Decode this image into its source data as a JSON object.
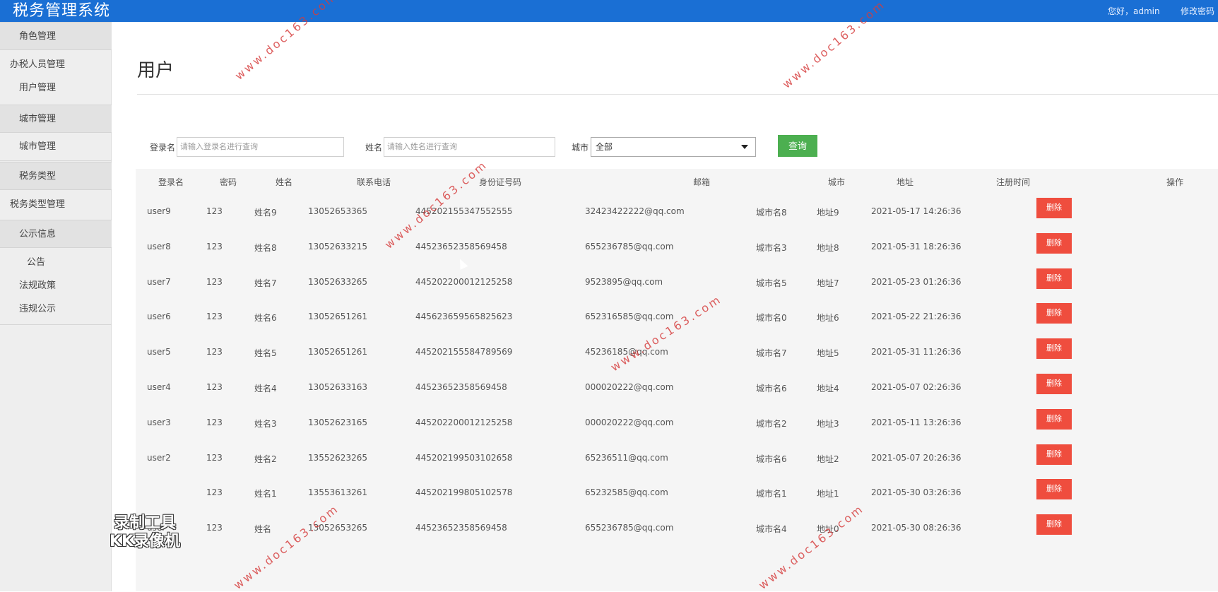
{
  "app": {
    "title": "税务管理系统",
    "greeting": "您好，admin",
    "change_password": "修改密码"
  },
  "sidebar": {
    "items": [
      {
        "label": "角色管理",
        "kind": "group"
      },
      {
        "label": "办税人员管理",
        "kind": "plain"
      },
      {
        "label": "用户管理",
        "kind": "sub"
      },
      {
        "label": "城市管理",
        "kind": "group"
      },
      {
        "label": "城市管理",
        "kind": "plain"
      },
      {
        "label": "税务类型",
        "kind": "group"
      },
      {
        "label": "税务类型管理",
        "kind": "plain"
      },
      {
        "label": "公示信息",
        "kind": "group"
      },
      {
        "label": "公告",
        "kind": "sub"
      },
      {
        "label": "法规政策",
        "kind": "sub"
      },
      {
        "label": "违规公示",
        "kind": "sub"
      }
    ]
  },
  "page": {
    "title": "用户"
  },
  "filters": {
    "login_label": "登录名",
    "login_placeholder": "请输入登录名进行查询",
    "name_label": "姓名",
    "name_placeholder": "请输入姓名进行查询",
    "city_label": "城市",
    "city_value": "全部",
    "query_button": "查询"
  },
  "table": {
    "headers": [
      "登录名",
      "密码",
      "姓名",
      "联系电话",
      "身份证号码",
      "邮箱",
      "城市",
      "地址",
      "注册时间",
      "操作"
    ],
    "delete_label": "删除",
    "rows": [
      [
        "user9",
        "123",
        "姓名9",
        "13052653365",
        "445202155347552555",
        "32423422222@qq.com",
        "城市名8",
        "地址9",
        "2021-05-17 14:26:36"
      ],
      [
        "user8",
        "123",
        "姓名8",
        "13052633215",
        "445236523585694​58",
        "655236785@qq.com",
        "城市名3",
        "地址8",
        "2021-05-31 18:26:36"
      ],
      [
        "user7",
        "123",
        "姓名7",
        "13052633265",
        "445202200012125258",
        "9523895@qq.com",
        "城市名5",
        "地址7",
        "2021-05-23 01:26:36"
      ],
      [
        "user6",
        "123",
        "姓名6",
        "13052651261",
        "445623659565825623",
        "652316585@qq.com",
        "城市名0",
        "地址6",
        "2021-05-22 21:26:36"
      ],
      [
        "user5",
        "123",
        "姓名5",
        "13052651261",
        "445202155584789569",
        "45236185@qq.com",
        "城市名7",
        "地址5",
        "2021-05-31 11:26:36"
      ],
      [
        "user4",
        "123",
        "姓名4",
        "13052633163",
        "44523652358569458",
        "000020222@qq.com",
        "城市名6",
        "地址4",
        "2021-05-07 02:26:36"
      ],
      [
        "user3",
        "123",
        "姓名3",
        "13052623165",
        "445202200012125258",
        "000020222@qq.com",
        "城市名2",
        "地址3",
        "2021-05-11 13:26:36"
      ],
      [
        "user2",
        "123",
        "姓名2",
        "13552623265",
        "445202199503102658",
        "65236511@qq.com",
        "城市名6",
        "地址2",
        "2021-05-07 20:26:36"
      ],
      [
        "",
        "123",
        "姓名1",
        "13553613261",
        "445202199805102578",
        "65232585@qq.com",
        "城市名1",
        "地址1",
        "2021-05-30 03:26:36"
      ],
      [
        "user",
        "123",
        "姓名",
        "13052653265",
        "44523652358569458",
        "655236785@qq.com",
        "城市名4",
        "地址0",
        "2021-05-30 08:26:36"
      ]
    ]
  },
  "watermark": {
    "text": "www.doc163.com"
  },
  "recorder_label": [
    "录制工具",
    "KK录像机"
  ],
  "colors": {
    "topbar": "#1a6fd4",
    "query": "#4caf50",
    "delete": "#ef4d3e"
  }
}
